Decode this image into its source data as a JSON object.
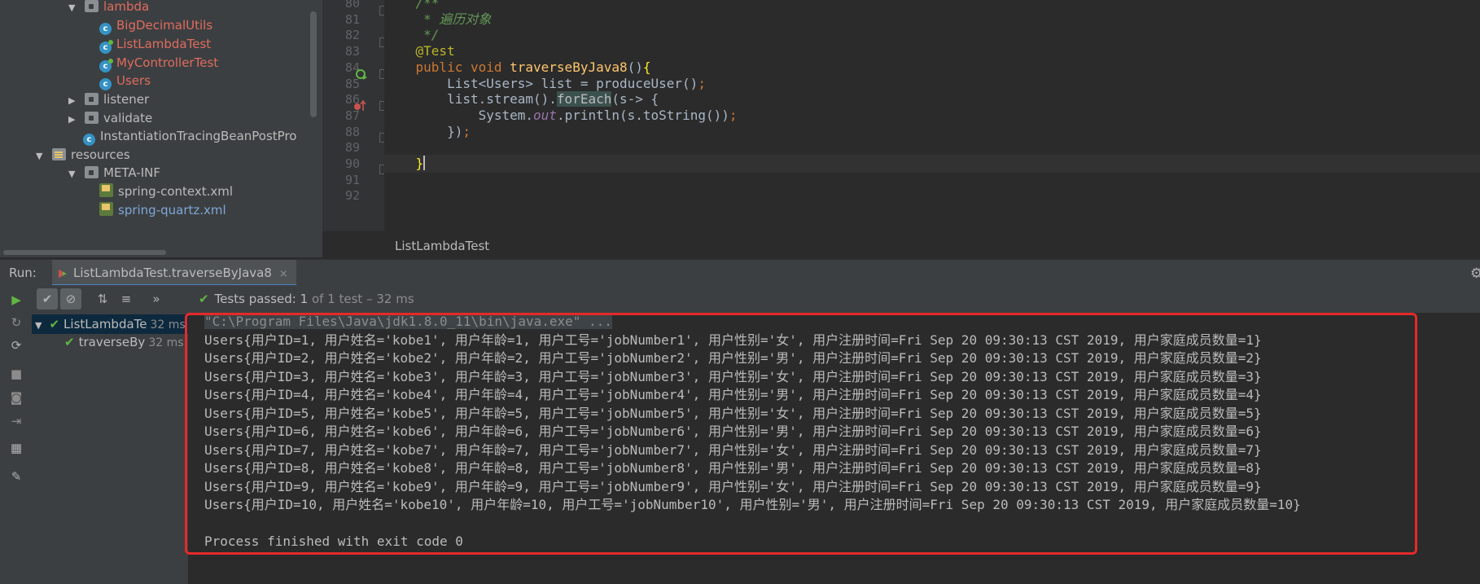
{
  "project_tree": {
    "items": [
      {
        "label": "lambda",
        "type": "folder",
        "expanded": true,
        "indent": 1,
        "color": "red"
      },
      {
        "label": "BigDecimalUtils",
        "type": "class",
        "indent": 2,
        "color": "red"
      },
      {
        "label": "ListLambdaTest",
        "type": "test-class",
        "indent": 2,
        "color": "red"
      },
      {
        "label": "MyControllerTest",
        "type": "test-class",
        "indent": 2,
        "color": "red"
      },
      {
        "label": "Users",
        "type": "class",
        "indent": 2,
        "color": "red"
      },
      {
        "label": "listener",
        "type": "folder",
        "expanded": false,
        "indent": 1,
        "color": "normal"
      },
      {
        "label": "validate",
        "type": "folder",
        "expanded": false,
        "indent": 1,
        "color": "normal"
      },
      {
        "label": "InstantiationTracingBeanPostPro",
        "type": "class",
        "indent": 1,
        "color": "normal"
      },
      {
        "label": "resources",
        "type": "resources",
        "expanded": true,
        "indent": 0,
        "color": "normal"
      },
      {
        "label": "META-INF",
        "type": "folder",
        "expanded": true,
        "indent": 1,
        "color": "normal"
      },
      {
        "label": "spring-context.xml",
        "type": "xml",
        "indent": 2,
        "color": "normal"
      },
      {
        "label": "spring-quartz.xml",
        "type": "xml",
        "indent": 2,
        "color": "blue"
      }
    ]
  },
  "editor": {
    "line_numbers": [
      "80",
      "81",
      "82",
      "83",
      "84",
      "85",
      "86",
      "87",
      "88",
      "89",
      "90",
      "91",
      "92"
    ],
    "lines": [
      {
        "parts": [
          {
            "c": "cm",
            "t": "    /**"
          }
        ]
      },
      {
        "parts": [
          {
            "c": "cm",
            "t": "     * 遍历对象"
          }
        ]
      },
      {
        "parts": [
          {
            "c": "cm",
            "t": "     */"
          }
        ]
      },
      {
        "parts": [
          {
            "c": "an",
            "t": "    @Test"
          }
        ]
      },
      {
        "parts": [
          {
            "c": "kw",
            "t": "    public void "
          },
          {
            "c": "fn",
            "t": "traverseByJava8"
          },
          {
            "c": "tx",
            "t": "()"
          },
          {
            "c": "brace",
            "t": "{"
          }
        ]
      },
      {
        "parts": [
          {
            "c": "tx",
            "t": "        List<Users> list = produceUser()"
          },
          {
            "c": "kw",
            "t": ";"
          }
        ]
      },
      {
        "parts": [
          {
            "c": "tx",
            "t": "        list.stream()."
          },
          {
            "c": "hl",
            "t": "forEach"
          },
          {
            "c": "tx",
            "t": "(s-> {"
          }
        ]
      },
      {
        "parts": [
          {
            "c": "tx",
            "t": "            System."
          },
          {
            "c": "st",
            "t": "out"
          },
          {
            "c": "tx",
            "t": ".println(s.toString())"
          },
          {
            "c": "kw",
            "t": ";"
          }
        ]
      },
      {
        "parts": [
          {
            "c": "tx",
            "t": "        })"
          },
          {
            "c": "kw",
            "t": ";"
          }
        ]
      },
      {
        "parts": [
          {
            "c": "tx",
            "t": ""
          }
        ]
      },
      {
        "parts": [
          {
            "c": "brace",
            "t": "    }"
          }
        ]
      },
      {
        "parts": [
          {
            "c": "tx",
            "t": ""
          }
        ]
      },
      {
        "parts": [
          {
            "c": "tx",
            "t": ""
          }
        ]
      }
    ],
    "breadcrumb": "ListLambdaTest"
  },
  "run_panel": {
    "label": "Run:",
    "tab_title": "ListLambdaTest.traverseByJava8",
    "tab_close": "×",
    "status_prefix": "Tests passed:",
    "status_count": "1",
    "status_suffix": "of 1 test – 32 ms",
    "expand_glyph": "»",
    "test_tree": [
      {
        "label": "ListLambdaTe",
        "time": "32 ms",
        "indent": 0
      },
      {
        "label": "traverseBy",
        "time": "32 ms",
        "indent": 1
      }
    ]
  },
  "console": {
    "command": "\"C:\\Program Files\\Java\\jdk1.8.0_11\\bin\\java.exe\" ...",
    "output": [
      "Users{用户ID=1, 用户姓名='kobe1', 用户年龄=1, 用户工号='jobNumber1', 用户性别='女', 用户注册时间=Fri Sep 20 09:30:13 CST 2019, 用户家庭成员数量=1}",
      "Users{用户ID=2, 用户姓名='kobe2', 用户年龄=2, 用户工号='jobNumber2', 用户性别='男', 用户注册时间=Fri Sep 20 09:30:13 CST 2019, 用户家庭成员数量=2}",
      "Users{用户ID=3, 用户姓名='kobe3', 用户年龄=3, 用户工号='jobNumber3', 用户性别='女', 用户注册时间=Fri Sep 20 09:30:13 CST 2019, 用户家庭成员数量=3}",
      "Users{用户ID=4, 用户姓名='kobe4', 用户年龄=4, 用户工号='jobNumber4', 用户性别='男', 用户注册时间=Fri Sep 20 09:30:13 CST 2019, 用户家庭成员数量=4}",
      "Users{用户ID=5, 用户姓名='kobe5', 用户年龄=5, 用户工号='jobNumber5', 用户性别='女', 用户注册时间=Fri Sep 20 09:30:13 CST 2019, 用户家庭成员数量=5}",
      "Users{用户ID=6, 用户姓名='kobe6', 用户年龄=6, 用户工号='jobNumber6', 用户性别='男', 用户注册时间=Fri Sep 20 09:30:13 CST 2019, 用户家庭成员数量=6}",
      "Users{用户ID=7, 用户姓名='kobe7', 用户年龄=7, 用户工号='jobNumber7', 用户性别='女', 用户注册时间=Fri Sep 20 09:30:13 CST 2019, 用户家庭成员数量=7}",
      "Users{用户ID=8, 用户姓名='kobe8', 用户年龄=8, 用户工号='jobNumber8', 用户性别='男', 用户注册时间=Fri Sep 20 09:30:13 CST 2019, 用户家庭成员数量=8}",
      "Users{用户ID=9, 用户姓名='kobe9', 用户年龄=9, 用户工号='jobNumber9', 用户性别='女', 用户注册时间=Fri Sep 20 09:30:13 CST 2019, 用户家庭成员数量=9}",
      "Users{用户ID=10, 用户姓名='kobe10', 用户年龄=10, 用户工号='jobNumber10', 用户性别='男', 用户注册时间=Fri Sep 20 09:30:13 CST 2019, 用户家庭成员数量=10}",
      "",
      "Process finished with exit code 0"
    ]
  },
  "colors": {
    "highlight_box": "#e52a2a",
    "pass_green": "#62b543",
    "vcs_modified_red": "#e06c5f"
  }
}
